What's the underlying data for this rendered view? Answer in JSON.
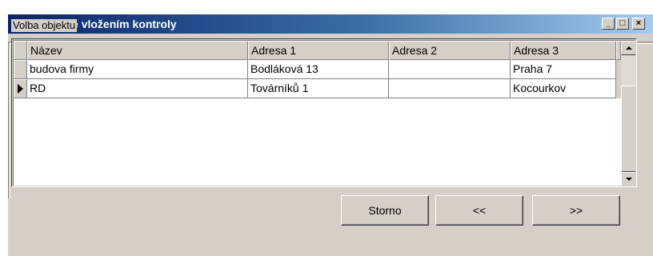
{
  "window": {
    "title": "Průvodce vložením kontroly",
    "minimize": "_",
    "maximize": "□",
    "close": "×"
  },
  "group": {
    "label": "Volba objektu"
  },
  "grid": {
    "columns": [
      "Název",
      "Adresa 1",
      "Adresa 2",
      "Adresa 3"
    ],
    "rows": [
      [
        "budova firmy",
        "Bodláková 13",
        "",
        "Praha 7"
      ],
      [
        "RD",
        "Továrníků 1",
        "",
        "Kocourkov"
      ]
    ],
    "selected_row": 1
  },
  "buttons": {
    "cancel": "Storno",
    "back": "<<",
    "next": ">>"
  },
  "colors": {
    "titlebar_start": "#0a246a",
    "titlebar_end": "#a6caf0",
    "face": "#d4d0c8"
  }
}
